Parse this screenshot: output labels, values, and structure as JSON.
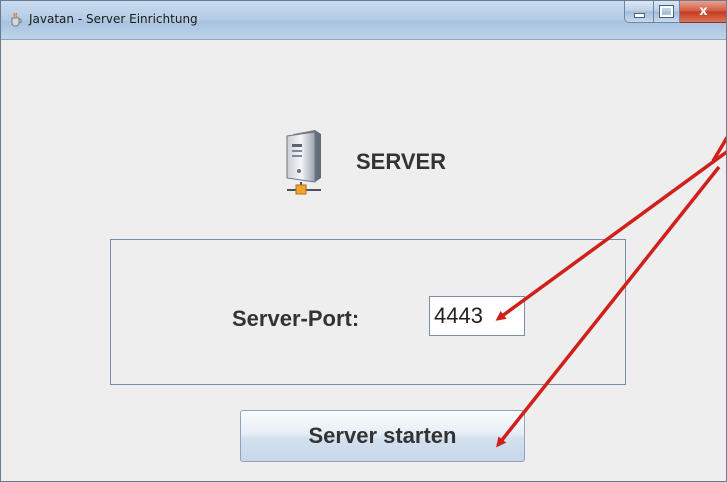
{
  "window": {
    "title": "Javatan - Server Einrichtung",
    "controls": {
      "minimize_icon": "minimize-icon",
      "maximize_icon": "maximize-icon",
      "close_icon": "close-icon",
      "close_glyph": "x"
    }
  },
  "header": {
    "icon": "server-icon",
    "title": "SERVER"
  },
  "form": {
    "port_label": "Server-Port:",
    "port_value": "4443"
  },
  "actions": {
    "start_label": "Server starten"
  },
  "colors": {
    "annotation_arrow": "#d0201b",
    "panel_border": "#7a8ea8"
  }
}
